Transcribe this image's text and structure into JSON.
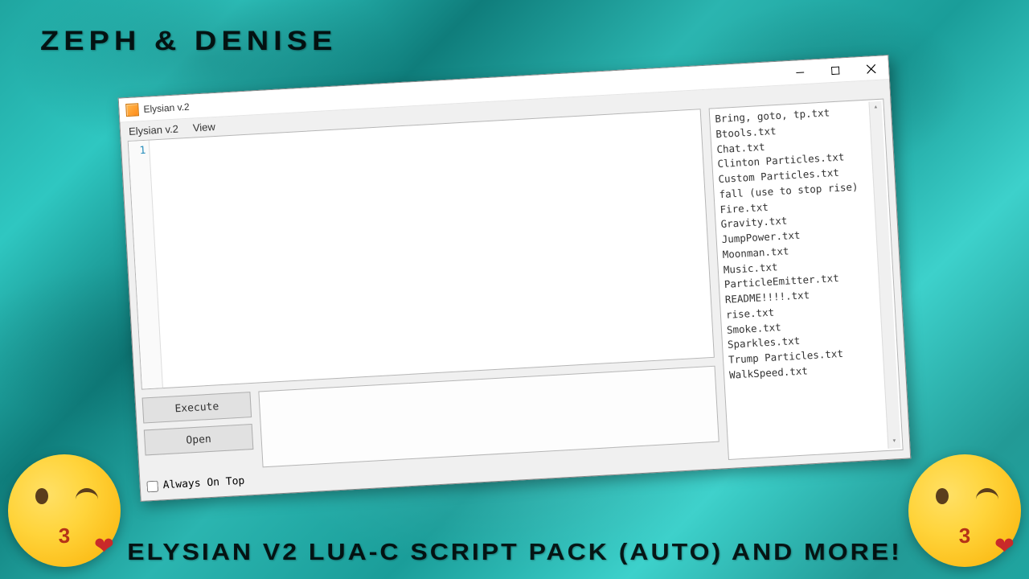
{
  "overlay": {
    "top_title": "ZEPH  &  DENISE",
    "bottom_title": "ELYSIAN V2 LUA-C SCRIPT PACK (AUTO) AND MORE!",
    "kiss_label": "3"
  },
  "window": {
    "title": "Elysian v.2"
  },
  "menu": {
    "item1": "Elysian v.2",
    "item2": "View"
  },
  "editor": {
    "line1": "1"
  },
  "buttons": {
    "execute": "Execute",
    "open": "Open"
  },
  "checkbox": {
    "always_on_top": "Always On Top"
  },
  "files": {
    "items": [
      "Bring, goto, tp.txt",
      "Btools.txt",
      "Chat.txt",
      "Clinton Particles.txt",
      "Custom Particles.txt",
      "fall (use to stop rise)",
      "Fire.txt",
      "Gravity.txt",
      "JumpPower.txt",
      "Moonman.txt",
      "Music.txt",
      "ParticleEmitter.txt",
      "README!!!!.txt",
      "rise.txt",
      "Smoke.txt",
      "Sparkles.txt",
      "Trump Particles.txt",
      "WalkSpeed.txt"
    ]
  }
}
